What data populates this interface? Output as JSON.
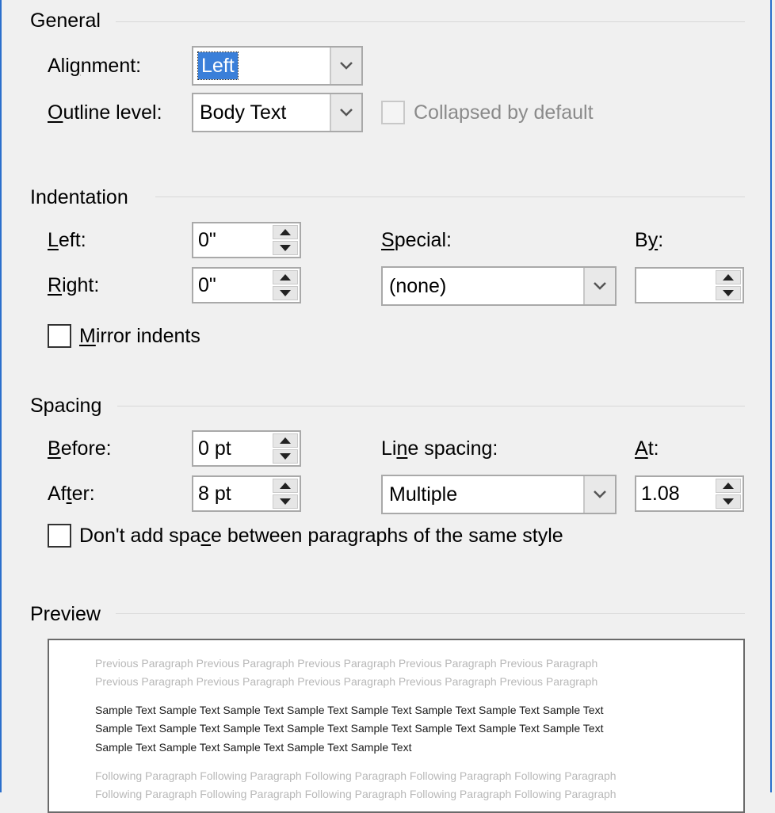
{
  "general": {
    "title": "General",
    "alignment": {
      "label_key": "Ali",
      "label_ul": "g",
      "label_rest": "nment:",
      "value": "Left"
    },
    "outline_level": {
      "label_ul": "O",
      "label_rest": "utline level:",
      "value": "Body Text"
    },
    "collapsed": {
      "label": "Collapsed by default",
      "checked": false,
      "enabled": false
    }
  },
  "indentation": {
    "title": "Indentation",
    "left": {
      "label_ul": "L",
      "label_rest": "eft:",
      "value": "0\""
    },
    "right": {
      "label_ul": "R",
      "label_rest": "ight:",
      "value": "0\""
    },
    "special": {
      "label_ul": "S",
      "label_rest": "pecial:",
      "value": "(none)"
    },
    "by": {
      "label_pre": "B",
      "label_ul": "y",
      "label_rest": ":",
      "value": ""
    },
    "mirror": {
      "label_ul": "M",
      "label_rest": "irror indents",
      "checked": false
    }
  },
  "spacing": {
    "title": "Spacing",
    "before": {
      "label_ul": "B",
      "label_rest": "efore:",
      "value": "0 pt"
    },
    "after": {
      "label_pre": "Af",
      "label_ul": "t",
      "label_rest": "er:",
      "value": "8 pt"
    },
    "line_spacing": {
      "label_pre": "Li",
      "label_ul": "n",
      "label_rest": "e spacing:",
      "value": "Multiple"
    },
    "at": {
      "label_ul": "A",
      "label_rest": "t:",
      "value": "1.08"
    },
    "dont_add": {
      "label_pre": "Don't add spa",
      "label_ul": "c",
      "label_rest": "e between paragraphs of the same style",
      "checked": false
    }
  },
  "preview": {
    "title": "Preview",
    "previous_lines": [
      "Previous Paragraph Previous Paragraph Previous Paragraph Previous Paragraph Previous Paragraph",
      "Previous Paragraph Previous Paragraph Previous Paragraph Previous Paragraph Previous Paragraph"
    ],
    "sample_lines": [
      "Sample Text Sample Text Sample Text Sample Text Sample Text Sample Text Sample Text Sample Text",
      "Sample Text Sample Text Sample Text Sample Text Sample Text Sample Text Sample Text Sample Text",
      "Sample Text Sample Text Sample Text Sample Text Sample Text"
    ],
    "following_lines": [
      "Following Paragraph Following Paragraph Following Paragraph Following Paragraph Following Paragraph",
      "Following Paragraph Following Paragraph Following Paragraph Following Paragraph Following Paragraph"
    ]
  },
  "icons": {
    "dropdown": "chevron-down-icon",
    "spin_up": "triangle-up-icon",
    "spin_down": "triangle-down-icon"
  },
  "colors": {
    "window_bg": "#f0f0f0",
    "selection": "#3a7fd9",
    "frame": "#2b6fcc",
    "preview_gray": "#b8b8b8"
  }
}
